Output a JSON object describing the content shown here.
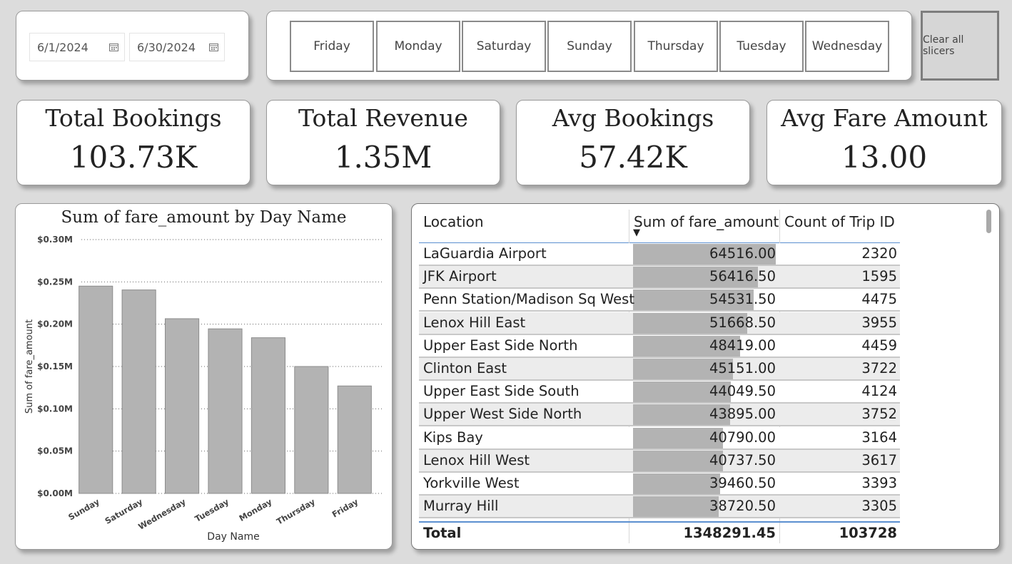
{
  "date_slicer": {
    "start": "6/1/2024",
    "end": "6/30/2024"
  },
  "day_slicer": {
    "days": [
      "Friday",
      "Monday",
      "Saturday",
      "Sunday",
      "Thursday",
      "Tuesday",
      "Wednesday"
    ]
  },
  "clear_button": {
    "label": "Clear all slicers"
  },
  "kpis": [
    {
      "title": "Total Bookings",
      "value": "103.73K"
    },
    {
      "title": "Total Revenue",
      "value": "1.35M"
    },
    {
      "title": "Avg Bookings",
      "value": "57.42K"
    },
    {
      "title": "Avg Fare Amount",
      "value": "13.00"
    }
  ],
  "chart_data": {
    "type": "bar",
    "title": "Sum of fare_amount by Day Name",
    "xlabel": "Day Name",
    "ylabel": "Sum of fare_amount",
    "categories": [
      "Sunday",
      "Saturday",
      "Wednesday",
      "Tuesday",
      "Monday",
      "Thursday",
      "Friday"
    ],
    "values": [
      245000,
      240500,
      206500,
      194500,
      184000,
      150000,
      127000
    ],
    "ylim": [
      0,
      300000
    ],
    "yticks": [
      "$0.00M",
      "$0.05M",
      "$0.10M",
      "$0.15M",
      "$0.20M",
      "$0.25M",
      "$0.30M"
    ],
    "grid": true,
    "bar_color": "#b3b3b3"
  },
  "table": {
    "headers": [
      "Location",
      "Sum of fare_amount",
      "Count of Trip ID"
    ],
    "sort_indicator": "▼",
    "rows": [
      {
        "location": "LaGuardia Airport",
        "fare": "64516.00",
        "fare_value": 64516.0,
        "count": "2320"
      },
      {
        "location": "JFK Airport",
        "fare": "56416.50",
        "fare_value": 56416.5,
        "count": "1595"
      },
      {
        "location": "Penn Station/Madison Sq West",
        "fare": "54531.50",
        "fare_value": 54531.5,
        "count": "4475"
      },
      {
        "location": "Lenox Hill East",
        "fare": "51668.50",
        "fare_value": 51668.5,
        "count": "3955"
      },
      {
        "location": "Upper East Side North",
        "fare": "48419.00",
        "fare_value": 48419.0,
        "count": "4459"
      },
      {
        "location": "Clinton East",
        "fare": "45151.00",
        "fare_value": 45151.0,
        "count": "3722"
      },
      {
        "location": "Upper East Side South",
        "fare": "44049.50",
        "fare_value": 44049.5,
        "count": "4124"
      },
      {
        "location": "Upper West Side North",
        "fare": "43895.00",
        "fare_value": 43895.0,
        "count": "3752"
      },
      {
        "location": "Kips Bay",
        "fare": "40790.00",
        "fare_value": 40790.0,
        "count": "3164"
      },
      {
        "location": "Lenox Hill West",
        "fare": "40737.50",
        "fare_value": 40737.5,
        "count": "3617"
      },
      {
        "location": "Yorkville West",
        "fare": "39460.50",
        "fare_value": 39460.5,
        "count": "3393"
      },
      {
        "location": "Murray Hill",
        "fare": "38720.50",
        "fare_value": 38720.5,
        "count": "3305"
      }
    ],
    "total": {
      "label": "Total",
      "fare": "1348291.45",
      "count": "103728"
    }
  }
}
